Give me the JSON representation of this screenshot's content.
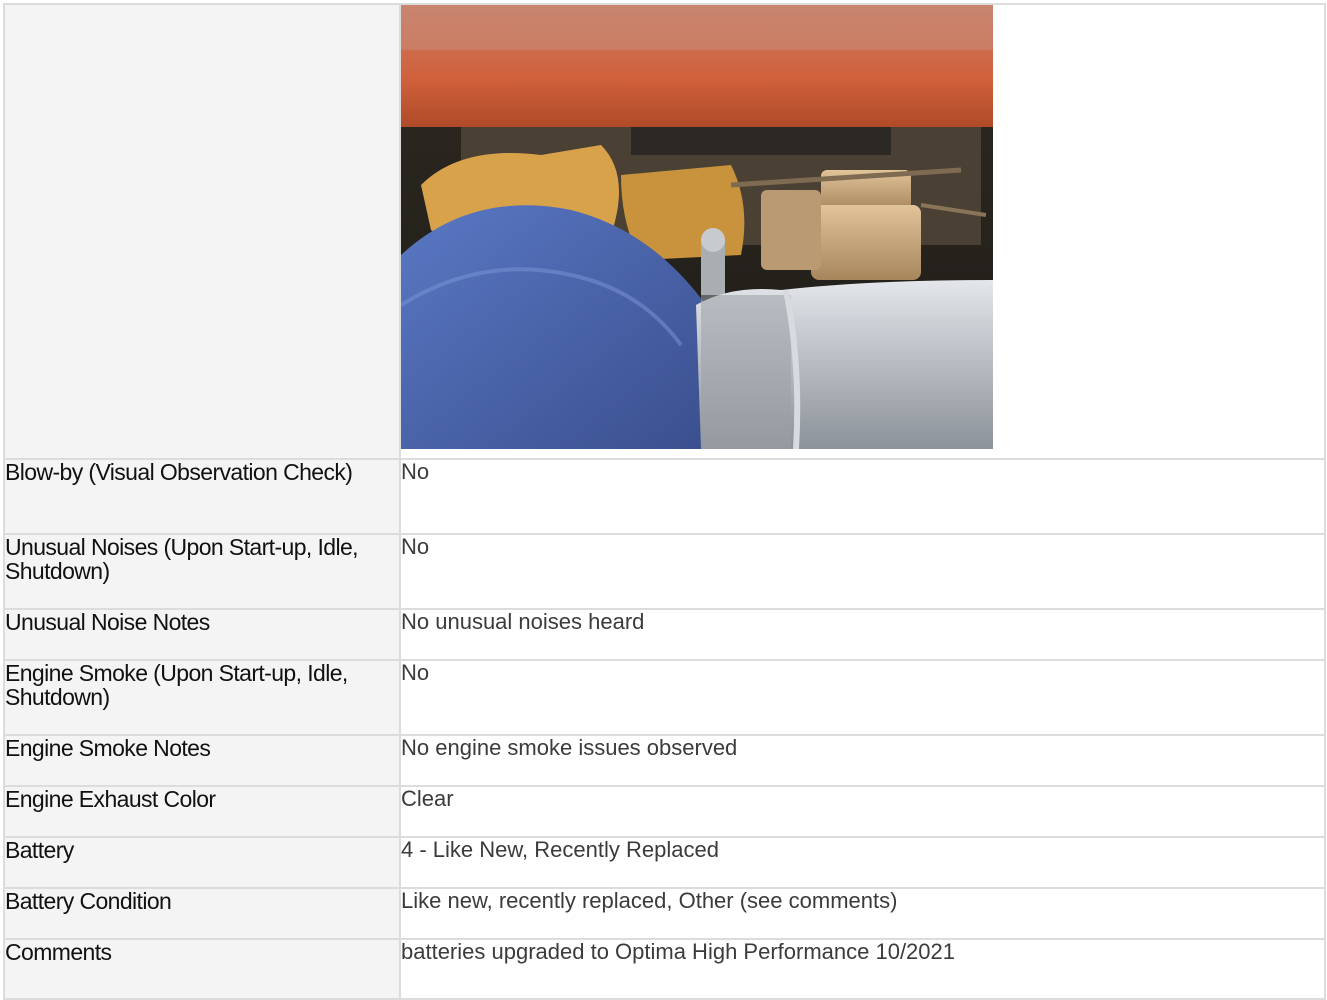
{
  "photo": {
    "subject": "engine-compartment-photo"
  },
  "rows": [
    {
      "label": "Blow-by (Visual Observation Check)",
      "value": "No"
    },
    {
      "label": "Unusual Noises (Upon Start-up, Idle, Shutdown)",
      "value": "No"
    },
    {
      "label": "Unusual Noise Notes",
      "value": "No unusual noises heard"
    },
    {
      "label": "Engine Smoke (Upon Start-up, Idle, Shutdown)",
      "value": "No"
    },
    {
      "label": "Engine Smoke Notes",
      "value": "No engine smoke issues observed"
    },
    {
      "label": "Engine Exhaust Color",
      "value": "Clear"
    },
    {
      "label": "Battery",
      "value": "4 - Like New, Recently Replaced"
    },
    {
      "label": "Battery Condition",
      "value": "Like new, recently replaced, Other (see comments)"
    },
    {
      "label": "Comments",
      "value": "batteries upgraded to Optima High Performance 10/2021"
    }
  ]
}
